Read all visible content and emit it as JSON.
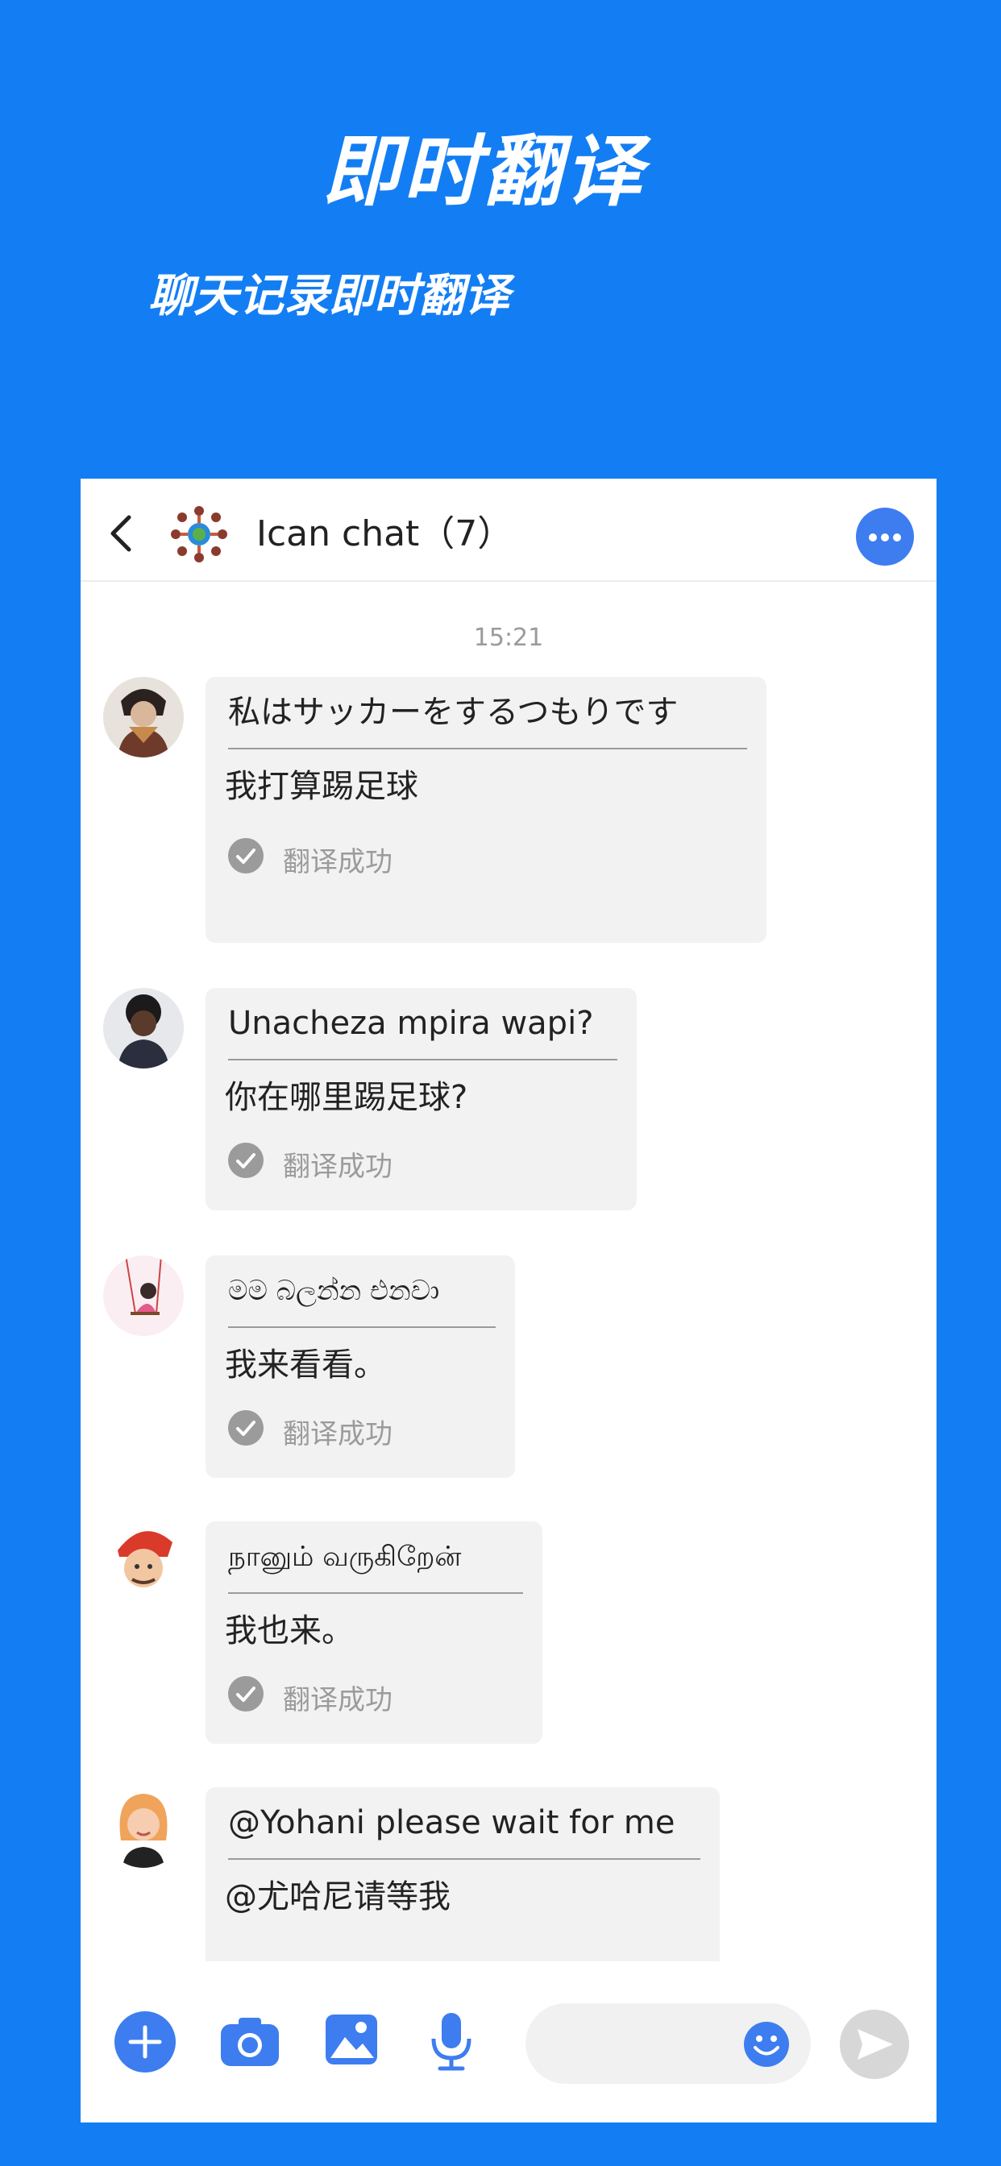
{
  "hero": {
    "title": "即时翻译",
    "subtitle": "聊天记录即时翻译"
  },
  "header": {
    "title": "Ican chat（7）"
  },
  "chat": {
    "timestamp": "15:21",
    "messages": [
      {
        "original": "私はサッカーをするつもりです",
        "translation": "我打算踢足球",
        "status": "翻译成功"
      },
      {
        "original": "Unacheza mpira wapi?",
        "translation": "你在哪里踢足球?",
        "status": "翻译成功"
      },
      {
        "original": "මම බලන්න එනවා",
        "translation": "我来看看。",
        "status": "翻译成功"
      },
      {
        "original": "நானும் வருகிறேன்",
        "translation": "我也来。",
        "status": "翻译成功"
      },
      {
        "original": "@Yohani please wait for me",
        "translation": "@尤哈尼请等我"
      }
    ]
  },
  "colors": {
    "background": "#137ef3",
    "accent": "#3d7df0",
    "bubble": "#f2f2f2"
  }
}
